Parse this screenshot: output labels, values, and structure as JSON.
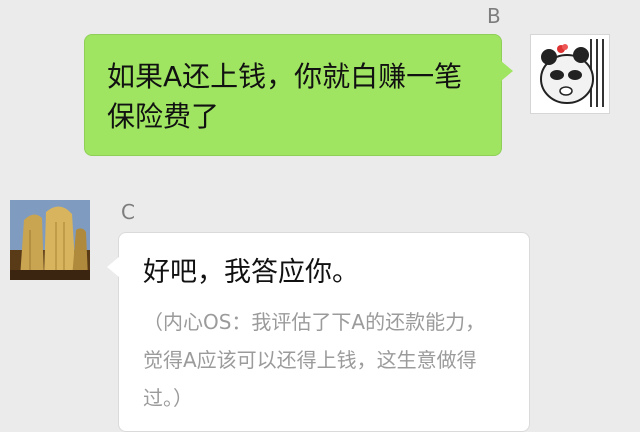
{
  "messages": [
    {
      "sender": "B",
      "text": "如果A还上钱，你就白赚一笔保险费了"
    },
    {
      "sender": "C",
      "text": "好吧，我答应你。",
      "subtext": "（内心OS：我评估了下A的还款能力，觉得A应该可以还得上钱，这生意做得过。）"
    }
  ]
}
